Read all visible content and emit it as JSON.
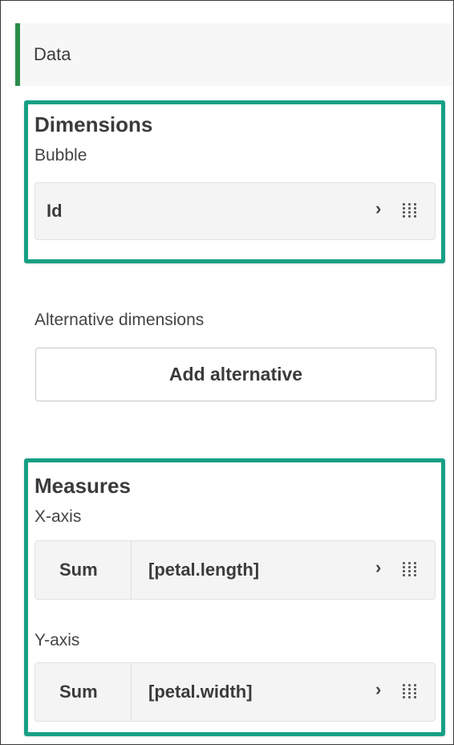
{
  "data_tab": {
    "label": "Data"
  },
  "dimensions": {
    "heading": "Dimensions",
    "bubble_label": "Bubble",
    "field": {
      "name": "Id"
    }
  },
  "alternative_dimensions": {
    "label": "Alternative dimensions",
    "button": "Add alternative"
  },
  "measures": {
    "heading": "Measures",
    "x_axis": {
      "label": "X-axis",
      "aggregation": "Sum",
      "field": "[petal.length]"
    },
    "y_axis": {
      "label": "Y-axis",
      "aggregation": "Sum",
      "field": "[petal.width]"
    }
  },
  "chevron_glyph": "›",
  "icons": {
    "expand": "chevron-right-icon",
    "drag": "drag-handle-icon"
  },
  "colors": {
    "highlight": "#17a085",
    "active_tab_accent": "#2c8c4a",
    "row_background": "#f4f4f4"
  }
}
